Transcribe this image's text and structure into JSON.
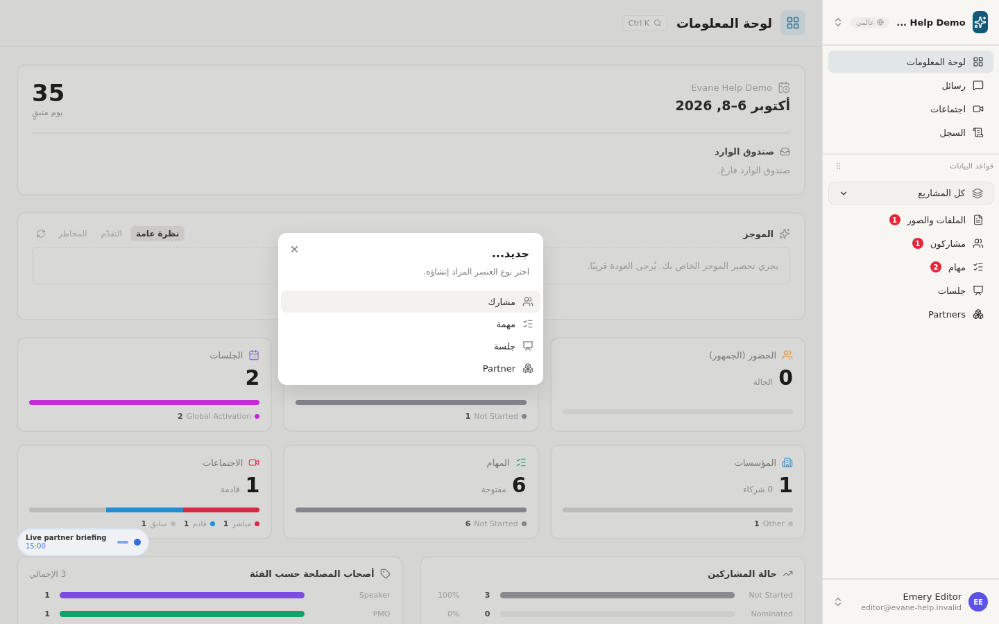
{
  "header": {
    "title": "لوحة المعلومات",
    "search_shortcut": "Ctrl K"
  },
  "event": {
    "org": "Evane Help Demo",
    "dates": "أكتوبر 6–8, 2026",
    "countdown": "35",
    "countdown_label": "يوم متبقٍ",
    "inbox_title": "صندوق الوارد",
    "inbox_empty": "صندوق الوارد فارغ."
  },
  "brief": {
    "title": "الموجز",
    "tabs": [
      {
        "label": "نظرة عامة",
        "selected": true
      },
      {
        "label": "التقدّم",
        "selected": false
      },
      {
        "label": "المخاطر",
        "selected": false
      }
    ],
    "message": "يجري تحضير الموجز الخاص بك. يُرجى العودة قريبًا."
  },
  "stats": [
    {
      "kind": "users",
      "title": "الحضور (الجمهور)",
      "value": "0",
      "sublabel": "الحالة"
    },
    {
      "legend": [
        {
          "count": "1",
          "label": "Not Started",
          "color": "#85848c"
        }
      ]
    },
    {
      "kind": "calendar",
      "title": "الجلسات",
      "value": "2",
      "legend": [
        {
          "count": "2",
          "label": "Global Activation",
          "color": "#c42bd6"
        }
      ]
    },
    {
      "kind": "building",
      "title": "المؤسسات",
      "value": "1",
      "sublabel": "0 شركاء",
      "legend": [
        {
          "count": "1",
          "label": "Other",
          "color": "#bdbcba"
        }
      ]
    },
    {
      "kind": "tasks",
      "title": "المهام",
      "value": "6",
      "sublabel": "مفتوحة",
      "legend": [
        {
          "count": "6",
          "label": "Not Started",
          "color": "#85848c"
        }
      ]
    },
    {
      "kind": "video",
      "title": "الاجتماعات",
      "value": "1",
      "sublabel": "قادمة",
      "legend": [
        {
          "count": "1",
          "label": "مباشر",
          "color": "#dc2846"
        },
        {
          "count": "1",
          "label": "قادم",
          "color": "#1f8fd6"
        },
        {
          "count": "1",
          "label": "سابق",
          "color": "#bdbcba"
        }
      ]
    }
  ],
  "participant_status": {
    "title": "حالة المشاركين",
    "rows": [
      {
        "label": "Not Started",
        "count": "3",
        "percent": "100%"
      },
      {
        "label": "Nominated",
        "count": "0",
        "percent": "0%"
      }
    ]
  },
  "stakeholders": {
    "title": "أصحاب المصلحة حسب الفئة",
    "total": "3 الإجمالي",
    "rows": [
      {
        "label": "Speaker",
        "count": "1",
        "level": 1,
        "color": "#7c4ddc"
      },
      {
        "label": "PMO",
        "count": "1",
        "level": 1,
        "color": "#10a36a"
      }
    ]
  },
  "toast": {
    "title": "Live partner briefing",
    "time": "15:00"
  },
  "dialog": {
    "title": "جديد...",
    "subtitle": "اختر نوع العنصر المراد إنشاؤه.",
    "items": [
      {
        "label": "مشارك",
        "kind": "users",
        "selected": true
      },
      {
        "label": "مهمة",
        "kind": "tasks",
        "selected": false
      },
      {
        "label": "جلسة",
        "kind": "sessions",
        "selected": false
      },
      {
        "label": "Partner",
        "kind": "partners",
        "selected": false
      }
    ]
  },
  "sidebar": {
    "workspace": "... Help Demo",
    "scope": "عالمي",
    "nav": [
      {
        "label": "لوحة المعلومات",
        "kind": "dashboard",
        "selected": true
      },
      {
        "label": "رسائل",
        "kind": "messages",
        "selected": false
      },
      {
        "label": "اجتماعات",
        "kind": "video",
        "selected": false
      },
      {
        "label": "السجل",
        "kind": "log",
        "selected": false
      }
    ],
    "section_title": "قواعد البيانات",
    "project_filter": "كل المشاريع",
    "databases": [
      {
        "label": "الملفات والصور",
        "kind": "file",
        "badge": "1",
        "selected": false
      },
      {
        "label": "مشاركون",
        "kind": "users",
        "badge": "1",
        "selected": false
      },
      {
        "label": "مهام",
        "kind": "tasks",
        "badge": "2",
        "selected": false
      },
      {
        "label": "جلسات",
        "kind": "sessions",
        "selected": false
      },
      {
        "label": "Partners",
        "kind": "partners",
        "selected": false
      }
    ],
    "user": {
      "initials": "EE",
      "name": "Emery Editor",
      "email": "editor@evane-help.invalid"
    }
  }
}
